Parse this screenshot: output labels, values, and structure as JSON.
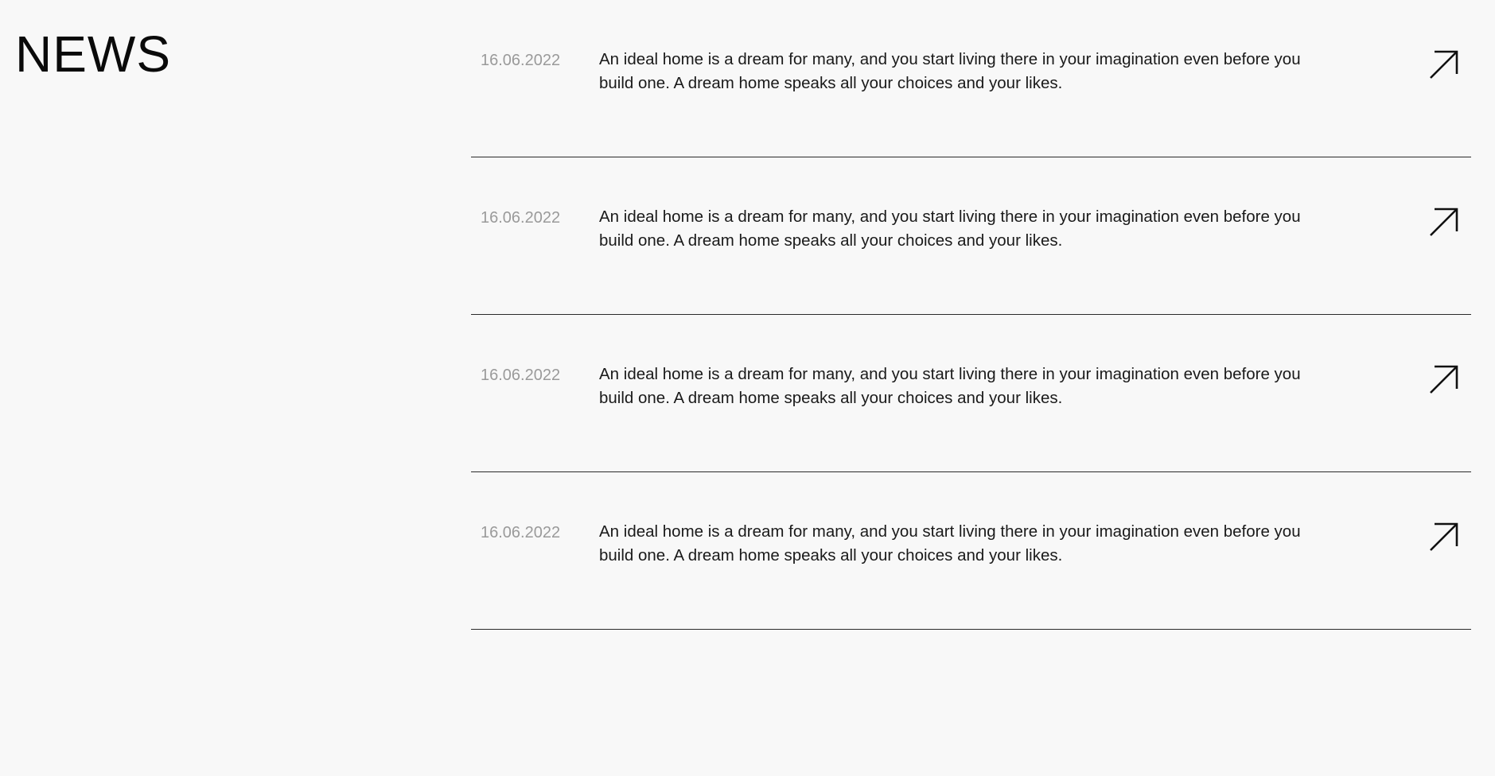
{
  "page": {
    "title": "NEWS"
  },
  "news": {
    "items": [
      {
        "date": "16.06.2022",
        "text": "An ideal home is a dream for many, and you start living there in your imagination even before you build one. A dream home speaks all your choices and your likes.",
        "icon": "arrow-up-right-icon"
      },
      {
        "date": "16.06.2022",
        "text": "An ideal home is a dream for many, and you start living there in your imagination even before you build one. A dream home speaks all your choices and your likes.",
        "icon": "arrow-up-right-icon"
      },
      {
        "date": "16.06.2022",
        "text": "An ideal home is a dream for many, and you start living there in your imagination even before you build one. A dream home speaks all your choices and your likes.",
        "icon": "arrow-up-right-icon"
      },
      {
        "date": "16.06.2022",
        "text": "An ideal home is a dream for many, and you start living there in your imagination even before you build one. A dream home speaks all your choices and your likes.",
        "icon": "arrow-up-right-icon"
      }
    ]
  },
  "colors": {
    "background": "#f8f8f8",
    "text": "#1a1a1a",
    "date": "#9a9a9a",
    "divider": "#2a2a2a"
  }
}
